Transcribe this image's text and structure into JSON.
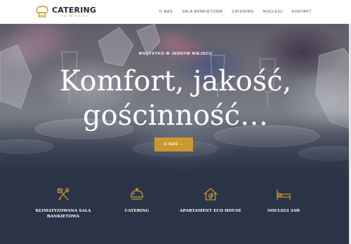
{
  "brand": {
    "title": "CATERING",
    "subtitle": "SUWAŁKI",
    "accent": "#c9992f",
    "dark": "#2b3446"
  },
  "nav": [
    {
      "label": "O NAS"
    },
    {
      "label": "SALA BANKIETOWA"
    },
    {
      "label": "CATERING"
    },
    {
      "label": "NOCLEGI"
    },
    {
      "label": "KONTAKT"
    }
  ],
  "hero": {
    "subtitle": "WSZYSTKO W JEDNYM MIEJSCU",
    "title_line1": "Komfort, jakość,",
    "title_line2": "gościnność…",
    "button": "O NAS →"
  },
  "features": [
    {
      "icon": "cutlery-icon",
      "label_line1": "KLIMATYZOWANA SALA",
      "label_line2": "BANKIETOWA"
    },
    {
      "icon": "cloche-icon",
      "label_line1": "CATERING",
      "label_line2": ""
    },
    {
      "icon": "eco-house-icon",
      "label_line1": "APARTAMENT ECO HOUSE",
      "label_line2": ""
    },
    {
      "icon": "bed-icon",
      "label_line1": "NOCLEGI 24H",
      "label_line2": ""
    }
  ]
}
